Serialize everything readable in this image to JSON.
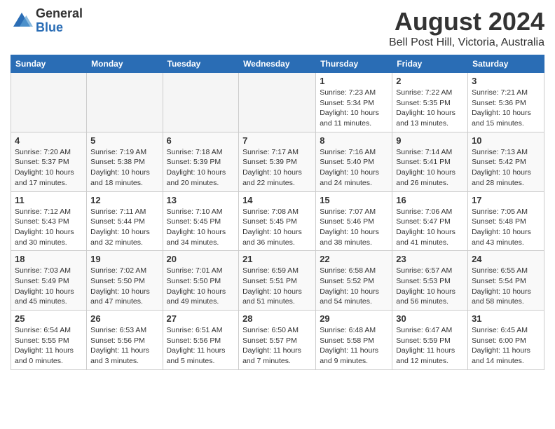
{
  "logo": {
    "general": "General",
    "blue": "Blue"
  },
  "title": "August 2024",
  "location": "Bell Post Hill, Victoria, Australia",
  "days_of_week": [
    "Sunday",
    "Monday",
    "Tuesday",
    "Wednesday",
    "Thursday",
    "Friday",
    "Saturday"
  ],
  "weeks": [
    [
      {
        "num": "",
        "info": "",
        "empty": true
      },
      {
        "num": "",
        "info": "",
        "empty": true
      },
      {
        "num": "",
        "info": "",
        "empty": true
      },
      {
        "num": "",
        "info": "",
        "empty": true
      },
      {
        "num": "1",
        "info": "Sunrise: 7:23 AM\nSunset: 5:34 PM\nDaylight: 10 hours\nand 11 minutes.",
        "empty": false
      },
      {
        "num": "2",
        "info": "Sunrise: 7:22 AM\nSunset: 5:35 PM\nDaylight: 10 hours\nand 13 minutes.",
        "empty": false
      },
      {
        "num": "3",
        "info": "Sunrise: 7:21 AM\nSunset: 5:36 PM\nDaylight: 10 hours\nand 15 minutes.",
        "empty": false
      }
    ],
    [
      {
        "num": "4",
        "info": "Sunrise: 7:20 AM\nSunset: 5:37 PM\nDaylight: 10 hours\nand 17 minutes.",
        "empty": false
      },
      {
        "num": "5",
        "info": "Sunrise: 7:19 AM\nSunset: 5:38 PM\nDaylight: 10 hours\nand 18 minutes.",
        "empty": false
      },
      {
        "num": "6",
        "info": "Sunrise: 7:18 AM\nSunset: 5:39 PM\nDaylight: 10 hours\nand 20 minutes.",
        "empty": false
      },
      {
        "num": "7",
        "info": "Sunrise: 7:17 AM\nSunset: 5:39 PM\nDaylight: 10 hours\nand 22 minutes.",
        "empty": false
      },
      {
        "num": "8",
        "info": "Sunrise: 7:16 AM\nSunset: 5:40 PM\nDaylight: 10 hours\nand 24 minutes.",
        "empty": false
      },
      {
        "num": "9",
        "info": "Sunrise: 7:14 AM\nSunset: 5:41 PM\nDaylight: 10 hours\nand 26 minutes.",
        "empty": false
      },
      {
        "num": "10",
        "info": "Sunrise: 7:13 AM\nSunset: 5:42 PM\nDaylight: 10 hours\nand 28 minutes.",
        "empty": false
      }
    ],
    [
      {
        "num": "11",
        "info": "Sunrise: 7:12 AM\nSunset: 5:43 PM\nDaylight: 10 hours\nand 30 minutes.",
        "empty": false
      },
      {
        "num": "12",
        "info": "Sunrise: 7:11 AM\nSunset: 5:44 PM\nDaylight: 10 hours\nand 32 minutes.",
        "empty": false
      },
      {
        "num": "13",
        "info": "Sunrise: 7:10 AM\nSunset: 5:45 PM\nDaylight: 10 hours\nand 34 minutes.",
        "empty": false
      },
      {
        "num": "14",
        "info": "Sunrise: 7:08 AM\nSunset: 5:45 PM\nDaylight: 10 hours\nand 36 minutes.",
        "empty": false
      },
      {
        "num": "15",
        "info": "Sunrise: 7:07 AM\nSunset: 5:46 PM\nDaylight: 10 hours\nand 38 minutes.",
        "empty": false
      },
      {
        "num": "16",
        "info": "Sunrise: 7:06 AM\nSunset: 5:47 PM\nDaylight: 10 hours\nand 41 minutes.",
        "empty": false
      },
      {
        "num": "17",
        "info": "Sunrise: 7:05 AM\nSunset: 5:48 PM\nDaylight: 10 hours\nand 43 minutes.",
        "empty": false
      }
    ],
    [
      {
        "num": "18",
        "info": "Sunrise: 7:03 AM\nSunset: 5:49 PM\nDaylight: 10 hours\nand 45 minutes.",
        "empty": false
      },
      {
        "num": "19",
        "info": "Sunrise: 7:02 AM\nSunset: 5:50 PM\nDaylight: 10 hours\nand 47 minutes.",
        "empty": false
      },
      {
        "num": "20",
        "info": "Sunrise: 7:01 AM\nSunset: 5:50 PM\nDaylight: 10 hours\nand 49 minutes.",
        "empty": false
      },
      {
        "num": "21",
        "info": "Sunrise: 6:59 AM\nSunset: 5:51 PM\nDaylight: 10 hours\nand 51 minutes.",
        "empty": false
      },
      {
        "num": "22",
        "info": "Sunrise: 6:58 AM\nSunset: 5:52 PM\nDaylight: 10 hours\nand 54 minutes.",
        "empty": false
      },
      {
        "num": "23",
        "info": "Sunrise: 6:57 AM\nSunset: 5:53 PM\nDaylight: 10 hours\nand 56 minutes.",
        "empty": false
      },
      {
        "num": "24",
        "info": "Sunrise: 6:55 AM\nSunset: 5:54 PM\nDaylight: 10 hours\nand 58 minutes.",
        "empty": false
      }
    ],
    [
      {
        "num": "25",
        "info": "Sunrise: 6:54 AM\nSunset: 5:55 PM\nDaylight: 11 hours\nand 0 minutes.",
        "empty": false
      },
      {
        "num": "26",
        "info": "Sunrise: 6:53 AM\nSunset: 5:56 PM\nDaylight: 11 hours\nand 3 minutes.",
        "empty": false
      },
      {
        "num": "27",
        "info": "Sunrise: 6:51 AM\nSunset: 5:56 PM\nDaylight: 11 hours\nand 5 minutes.",
        "empty": false
      },
      {
        "num": "28",
        "info": "Sunrise: 6:50 AM\nSunset: 5:57 PM\nDaylight: 11 hours\nand 7 minutes.",
        "empty": false
      },
      {
        "num": "29",
        "info": "Sunrise: 6:48 AM\nSunset: 5:58 PM\nDaylight: 11 hours\nand 9 minutes.",
        "empty": false
      },
      {
        "num": "30",
        "info": "Sunrise: 6:47 AM\nSunset: 5:59 PM\nDaylight: 11 hours\nand 12 minutes.",
        "empty": false
      },
      {
        "num": "31",
        "info": "Sunrise: 6:45 AM\nSunset: 6:00 PM\nDaylight: 11 hours\nand 14 minutes.",
        "empty": false
      }
    ]
  ]
}
